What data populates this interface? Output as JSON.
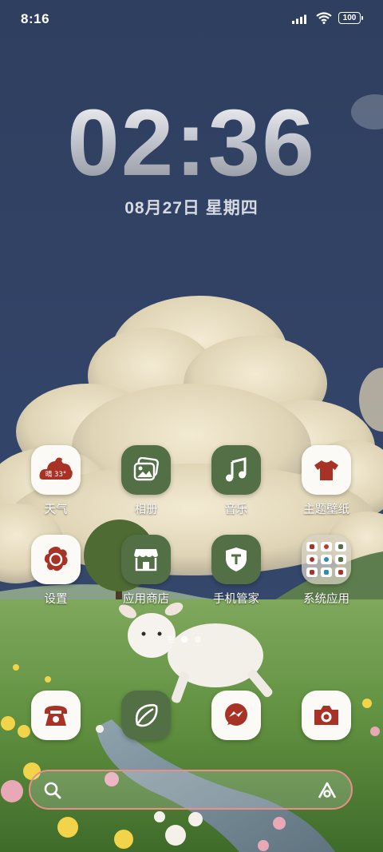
{
  "status_bar": {
    "time": "8:16",
    "battery": "100"
  },
  "clock": {
    "time": "02:36",
    "date": "08月27日  星期四"
  },
  "weather_widget": {
    "text": "晴 33°"
  },
  "apps": [
    {
      "label": "天气",
      "icon": "weather-icon"
    },
    {
      "label": "相册",
      "icon": "gallery-icon"
    },
    {
      "label": "音乐",
      "icon": "music-icon"
    },
    {
      "label": "主题壁纸",
      "icon": "tshirt-icon"
    },
    {
      "label": "设置",
      "icon": "settings-icon"
    },
    {
      "label": "应用商店",
      "icon": "store-icon"
    },
    {
      "label": "手机管家",
      "icon": "security-shield-icon"
    },
    {
      "label": "系统应用",
      "icon": "folder-icon"
    }
  ],
  "dock": [
    {
      "name": "phone",
      "icon": "phone-icon"
    },
    {
      "name": "browser",
      "icon": "browser-leaf-icon"
    },
    {
      "name": "messenger",
      "icon": "messenger-icon"
    },
    {
      "name": "camera",
      "icon": "camera-icon"
    }
  ],
  "page_indicator": {
    "pages": 2,
    "current": 1
  },
  "colors": {
    "accent_red": "#a93226",
    "icon_green": "#536f46",
    "search_border": "#e98f8a"
  }
}
